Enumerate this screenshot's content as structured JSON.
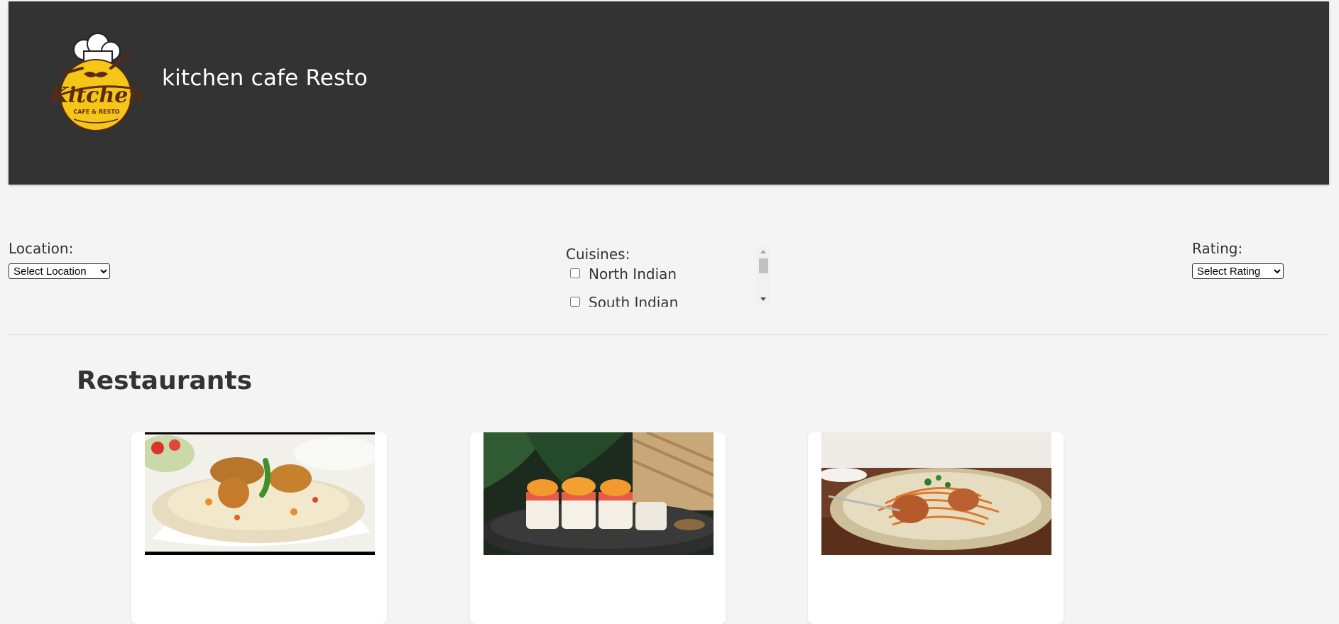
{
  "header": {
    "logo_text": "Kitchen",
    "logo_subtext": "CAFE & RESTO",
    "site_title": "kitchen cafe Resto"
  },
  "filters": {
    "location": {
      "label": "Location:",
      "selected": "Select Location"
    },
    "cuisines": {
      "label": "Cuisines:",
      "options": [
        {
          "label": "North Indian",
          "checked": false
        },
        {
          "label": "South Indian",
          "checked": false
        }
      ]
    },
    "rating": {
      "label": "Rating:",
      "selected": "Select Rating"
    }
  },
  "restaurants": {
    "heading": "Restaurants",
    "cards": [
      {
        "image": "biryani-chicken-rice"
      },
      {
        "image": "sushi-rolls-topped"
      },
      {
        "image": "spaghetti-meatball-plate"
      }
    ]
  },
  "colors": {
    "header_bg": "#333333",
    "page_bg": "#f4f4f4",
    "logo_yellow": "#f5c518",
    "logo_brown": "#5a2a12"
  }
}
